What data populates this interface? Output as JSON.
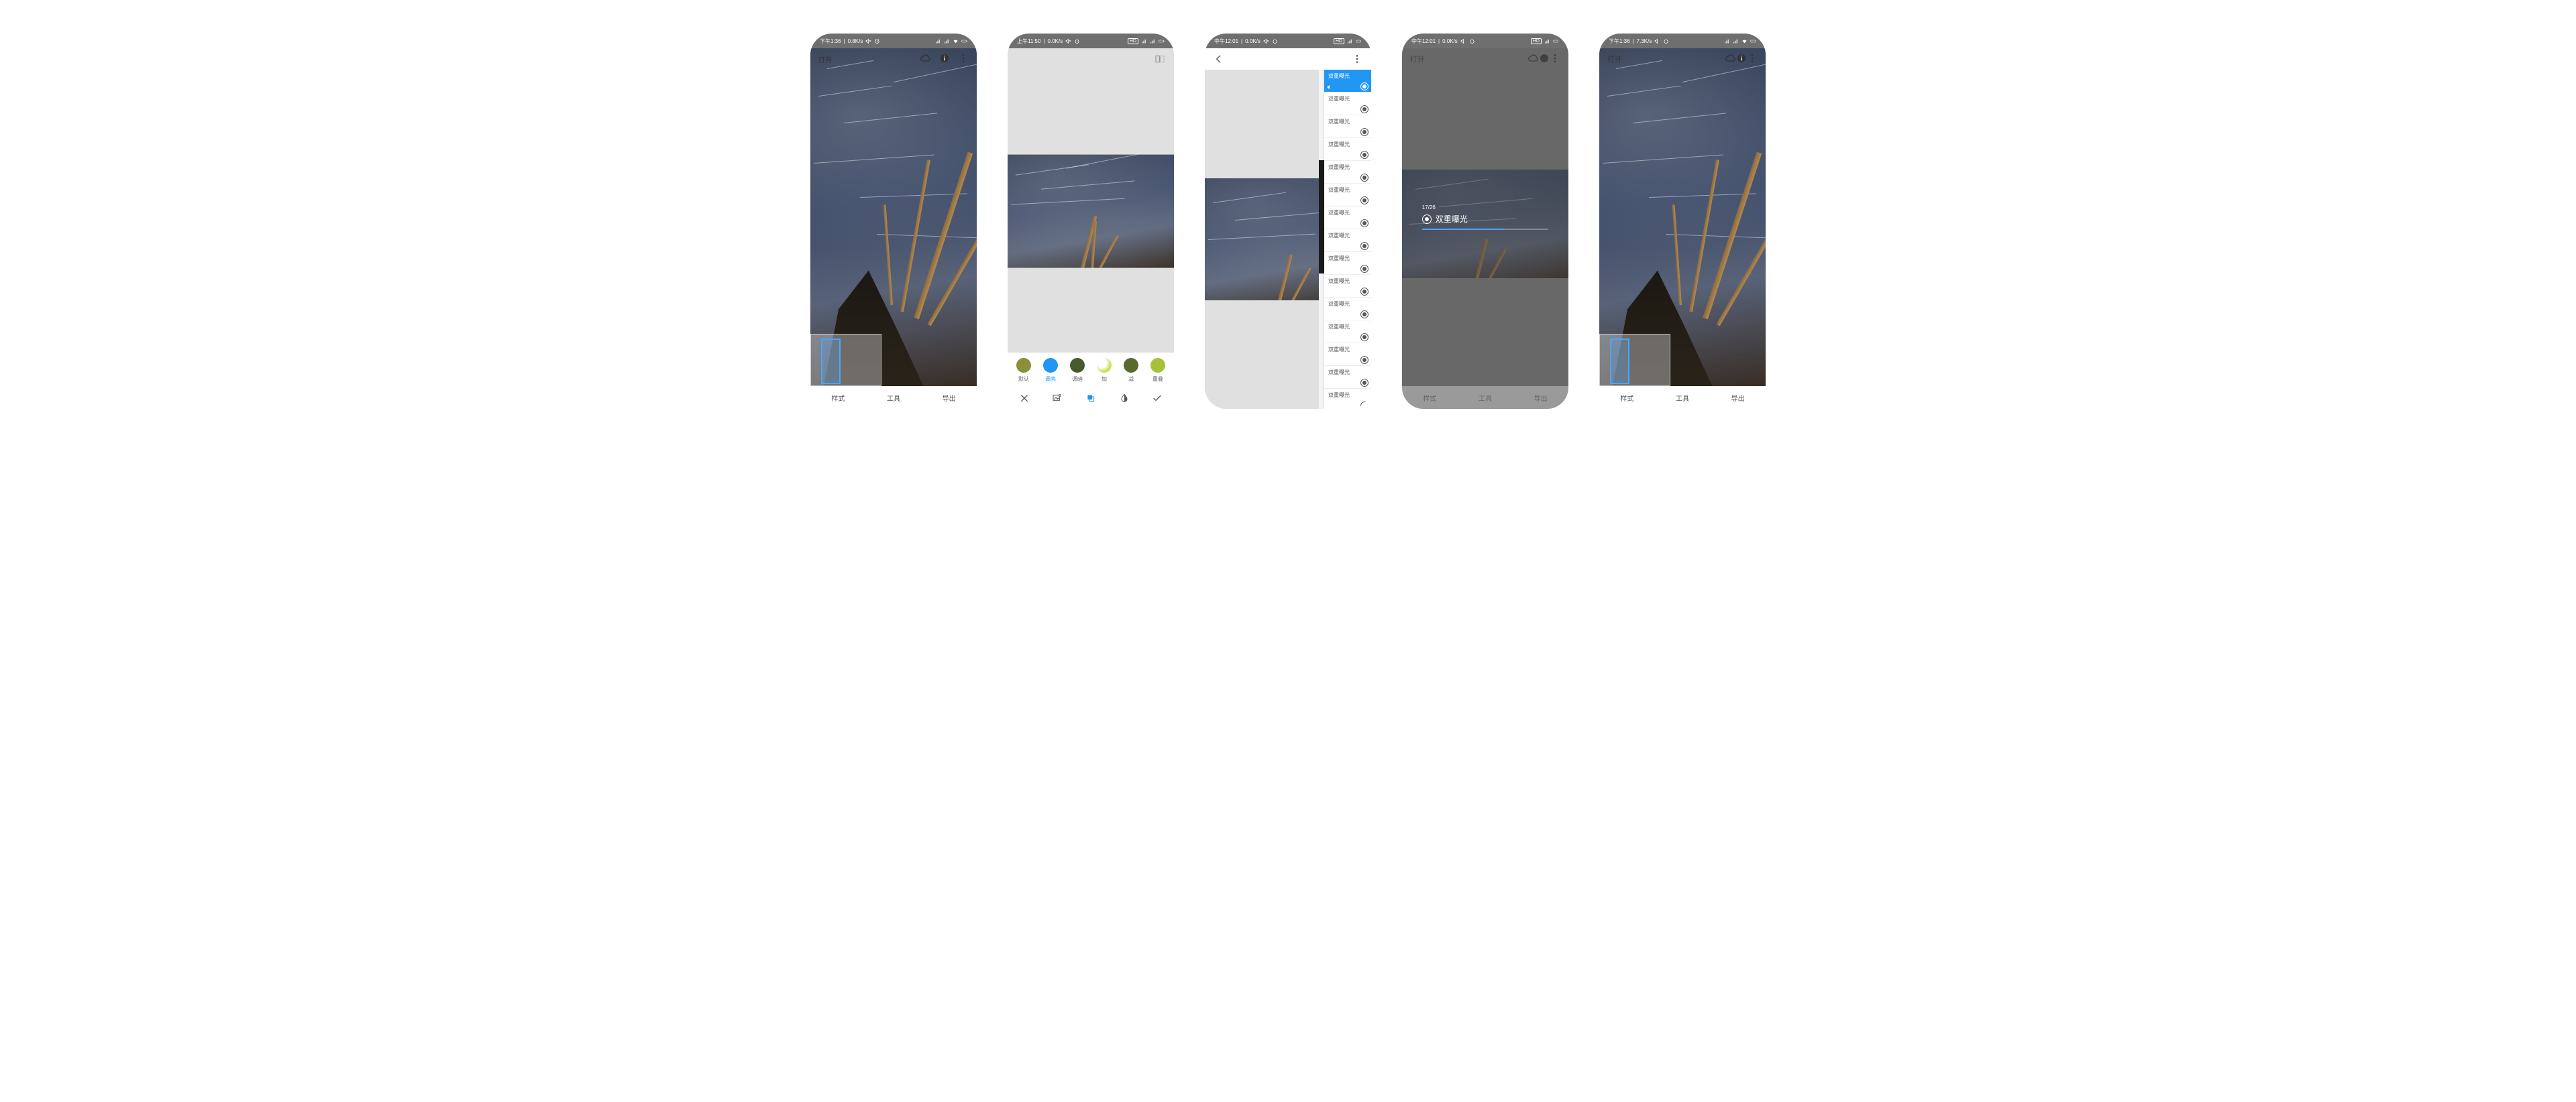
{
  "phones": {
    "p1": {
      "status": {
        "time": "下午1:36",
        "rate": "0.8K/s",
        "icons": "⏰",
        "right": "📶 ᯤ ▭"
      },
      "toolbar": {
        "open_label": "打开"
      },
      "nav": {
        "styles": "样式",
        "tools": "工具",
        "export": "导出"
      }
    },
    "p2": {
      "status": {
        "time": "上午11:50",
        "rate": "0.0K/s",
        "icons": "⏰",
        "right": "HD 📶 ▭"
      },
      "filters": {
        "f0": {
          "label": "默认",
          "color": "#8a8f3a"
        },
        "f1": {
          "label": "调亮",
          "color": "#2196f3"
        },
        "f2": {
          "label": "调暗",
          "color": "#4a5a2f"
        },
        "f3": {
          "label": "加",
          "color": "#cfe05a"
        },
        "f4": {
          "label": "减",
          "color": "#5a6a2f"
        },
        "f5": {
          "label": "重叠",
          "color": "#a6c23a"
        }
      }
    },
    "p3": {
      "status": {
        "time": "中午12:01",
        "rate": "0.0K/s",
        "icons": "⏰",
        "right": "HD 📶 ▭"
      },
      "history_label": "双重曝光"
    },
    "p4": {
      "status": {
        "time": "中午12:01",
        "rate": "0.0K/s",
        "icons": "⏰",
        "right": "HD 📶 ▭"
      },
      "toolbar": {
        "open_label": "打开"
      },
      "progress": {
        "count": "17/26",
        "label": "双重曝光"
      },
      "nav": {
        "styles": "样式",
        "tools": "工具",
        "export": "导出"
      }
    },
    "p5": {
      "status": {
        "time": "下午1:36",
        "rate": "7.3K/s",
        "icons": "⏰",
        "right": "📶 ᯤ ▭"
      },
      "toolbar": {
        "open_label": "打开"
      },
      "nav": {
        "styles": "样式",
        "tools": "工具",
        "export": "导出"
      }
    }
  }
}
